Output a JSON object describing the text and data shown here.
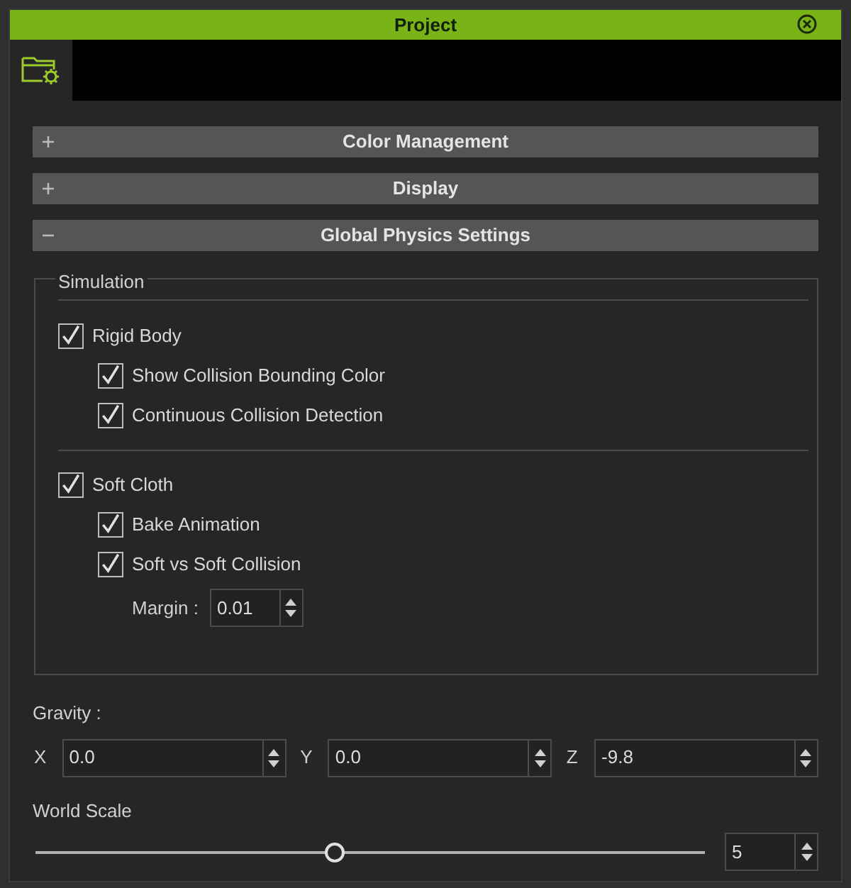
{
  "window": {
    "title": "Project"
  },
  "sections": [
    {
      "title": "Color Management",
      "expanded": false
    },
    {
      "title": "Display",
      "expanded": false
    },
    {
      "title": "Global Physics Settings",
      "expanded": true
    }
  ],
  "simulation": {
    "title": "Simulation",
    "groups": [
      {
        "label": "Rigid Body",
        "checked": true,
        "children": [
          {
            "label": "Show Collision Bounding Color",
            "checked": true
          },
          {
            "label": "Continuous Collision Detection",
            "checked": true
          }
        ]
      },
      {
        "label": "Soft Cloth",
        "checked": true,
        "children": [
          {
            "label": "Bake Animation",
            "checked": true
          },
          {
            "label": "Soft vs Soft Collision",
            "checked": true
          }
        ]
      }
    ],
    "margin": {
      "label": "Margin :",
      "value": "0.01"
    }
  },
  "gravity": {
    "label": "Gravity :",
    "axes": [
      {
        "label": "X",
        "value": "0.0"
      },
      {
        "label": "Y",
        "value": "0.0"
      },
      {
        "label": "Z",
        "value": "-9.8"
      }
    ]
  },
  "world_scale": {
    "label": "World Scale",
    "level": 0.447,
    "value": "5"
  }
}
